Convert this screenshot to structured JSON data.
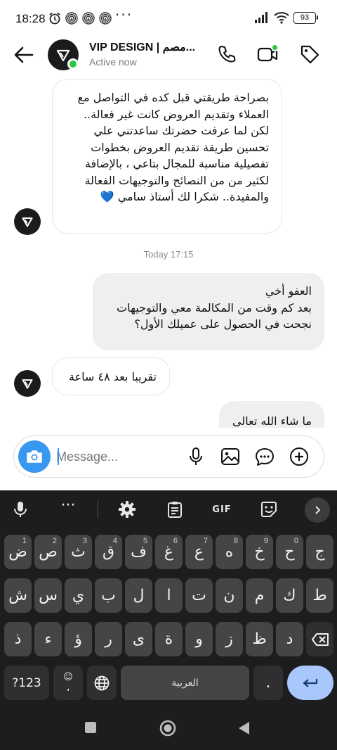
{
  "status_bar": {
    "time": "18:28",
    "battery": "93"
  },
  "header": {
    "name": "VIP DESIGN | مصم...",
    "status": "Active now"
  },
  "messages": [
    {
      "direction": "in",
      "lines": [
        "بصراحة طريقتي قبل كده في التواصل مع",
        "العملاء وتقديم العروض كانت غير فعالة..",
        "لكن لما عرفت حضرتك ساعدتني علي",
        "تحسين طريقة تقديم العروض بخطوات",
        "تفصيلية مناسبة للمجال بتاعي ، بالإضافة",
        "لكثير من من النصائح والتوجيهات الفعالة",
        "والمفيدة.. شكرا لك أستاذ سامي 💙"
      ]
    },
    {
      "direction": "out",
      "lines": [
        "العفو أخي",
        "بعد كم وقت من المكالمة معي والتوجيهات",
        "نجحت في الحصول على عميلك الأول؟"
      ]
    },
    {
      "direction": "in",
      "lines": [
        "تقريبا بعد ٤٨ ساعة"
      ]
    },
    {
      "direction": "out",
      "lines": [
        "ما شاء الله تعالى"
      ]
    }
  ],
  "timestamp": "Today 17:15",
  "composer": {
    "placeholder": "Message..."
  },
  "keyboard": {
    "toolbar": {
      "gif_label": "GIF"
    },
    "row1": [
      {
        "label": "ض",
        "hint": "1"
      },
      {
        "label": "ص",
        "hint": "2"
      },
      {
        "label": "ث",
        "hint": "3"
      },
      {
        "label": "ق",
        "hint": "4"
      },
      {
        "label": "ف",
        "hint": "5"
      },
      {
        "label": "غ",
        "hint": "6"
      },
      {
        "label": "ع",
        "hint": "7"
      },
      {
        "label": "ه",
        "hint": "8"
      },
      {
        "label": "خ",
        "hint": "9"
      },
      {
        "label": "ح",
        "hint": "0"
      },
      {
        "label": "ج",
        "hint": ""
      }
    ],
    "row2": [
      "ش",
      "س",
      "ي",
      "ب",
      "ل",
      "ا",
      "ت",
      "ن",
      "م",
      "ك",
      "ط"
    ],
    "row3": [
      "ذ",
      "ء",
      "ؤ",
      "ر",
      "ى",
      "ة",
      "و",
      "ز",
      "ظ",
      "د"
    ],
    "num_label": "?123",
    "space_label": "العربية",
    "emoji_comma": "،",
    "period": "."
  }
}
